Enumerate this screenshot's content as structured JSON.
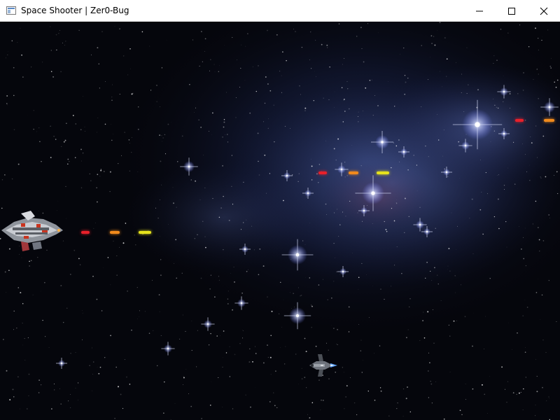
{
  "window": {
    "title": "Space Shooter | Zer0-Bug",
    "buttons": {
      "minimize_icon": "minimize-icon",
      "maximize_icon": "maximize-icon",
      "close_icon": "close-icon"
    }
  },
  "game": {
    "background_color": "#05060c",
    "nebula_color": "#4a5fa8",
    "laser_colors": [
      "#e8202a",
      "#f08a1c",
      "#e6e21c"
    ],
    "player_ship_icon": "fighter-ship-icon",
    "enemy_ship_icon": "battleship-icon",
    "thruster_color": "#5aa0ff"
  }
}
